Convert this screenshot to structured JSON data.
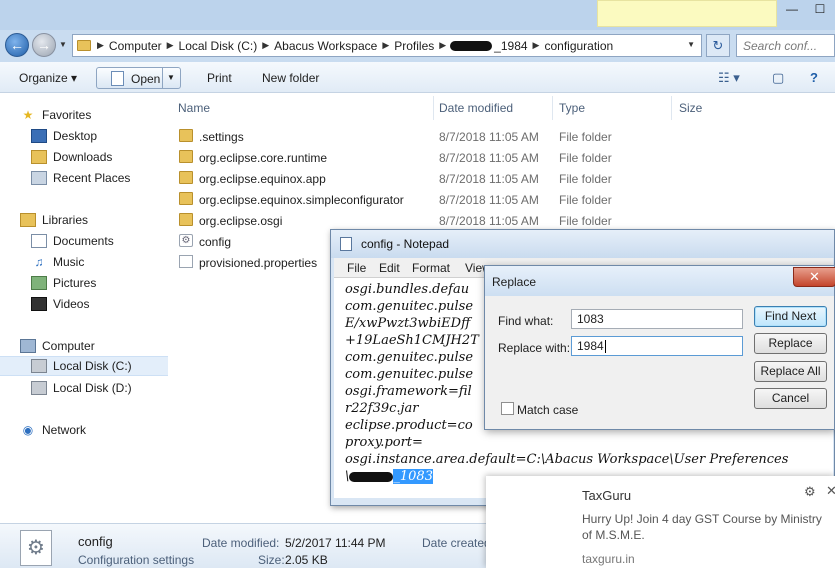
{
  "window": {
    "min_glyph": "—",
    "max_glyph": "☐"
  },
  "address": {
    "crumbs": [
      "Computer",
      "Local Disk (C:)",
      "Abacus Workspace",
      "Profiles",
      "_1984",
      "configuration"
    ],
    "search_placeholder": "Search conf..."
  },
  "toolbar": {
    "organize": "Organize ▾",
    "open": "Open",
    "print": "Print",
    "new_folder": "New folder"
  },
  "nav": {
    "favorites": "Favorites",
    "desktop": "Desktop",
    "downloads": "Downloads",
    "recent": "Recent Places",
    "libraries": "Libraries",
    "documents": "Documents",
    "music": "Music",
    "pictures": "Pictures",
    "videos": "Videos",
    "computer": "Computer",
    "local_c": "Local Disk (C:)",
    "local_d": "Local Disk (D:)",
    "network": "Network"
  },
  "columns": {
    "name": "Name",
    "date": "Date modified",
    "type": "Type",
    "size": "Size"
  },
  "files": [
    {
      "name": ".settings",
      "date": "8/7/2018 11:05 AM",
      "type": "File folder"
    },
    {
      "name": "org.eclipse.core.runtime",
      "date": "8/7/2018 11:05 AM",
      "type": "File folder"
    },
    {
      "name": "org.eclipse.equinox.app",
      "date": "8/7/2018 11:05 AM",
      "type": "File folder"
    },
    {
      "name": "org.eclipse.equinox.simpleconfigurator",
      "date": "8/7/2018 11:05 AM",
      "type": "File folder"
    },
    {
      "name": "org.eclipse.osgi",
      "date": "8/7/2018 11:05 AM",
      "type": "File folder"
    },
    {
      "name": "config",
      "date": "",
      "type": ""
    },
    {
      "name": "provisioned.properties",
      "date": "",
      "type": ""
    }
  ],
  "details": {
    "name": "config",
    "subtype": "Configuration settings",
    "modified_label": "Date modified:",
    "modified_value": "5/2/2017 11:44 PM",
    "size_label": "Size:",
    "size_value": "2.05 KB",
    "created_label": "Date created"
  },
  "notepad": {
    "title": "config - Notepad",
    "menu": [
      "File",
      "Edit",
      "Format",
      "View"
    ],
    "lines": [
      "osgi.bundles.defau",
      "com.genuitec.pulse",
      "E/xwPwzt3wbiEDff",
      "+19LaeSh1CMJH2T",
      "com.genuitec.pulse",
      "com.genuitec.pulse",
      "osgi.framework=fil",
      "r22f39c.jar",
      "eclipse.product=co",
      "proxy.port=",
      "osgi.instance.area.default=C:\\Abacus Workspace\\User Preferences"
    ],
    "last_prefix": "\\",
    "selected": "_1083"
  },
  "replace": {
    "title": "Replace",
    "find_label": "Find what:",
    "find_value": "1083",
    "replace_label": "Replace with:",
    "replace_value": "1984",
    "match_case": "Match case",
    "btn_find_next": "Find Next",
    "btn_replace": "Replace",
    "btn_replace_all": "Replace All",
    "btn_cancel": "Cancel"
  },
  "toast": {
    "source": "TaxGuru",
    "message_line1": "Hurry Up! Join 4 day GST Course by Ministry",
    "message_line2": "of M.S.M.E.",
    "url": "taxguru.in"
  }
}
